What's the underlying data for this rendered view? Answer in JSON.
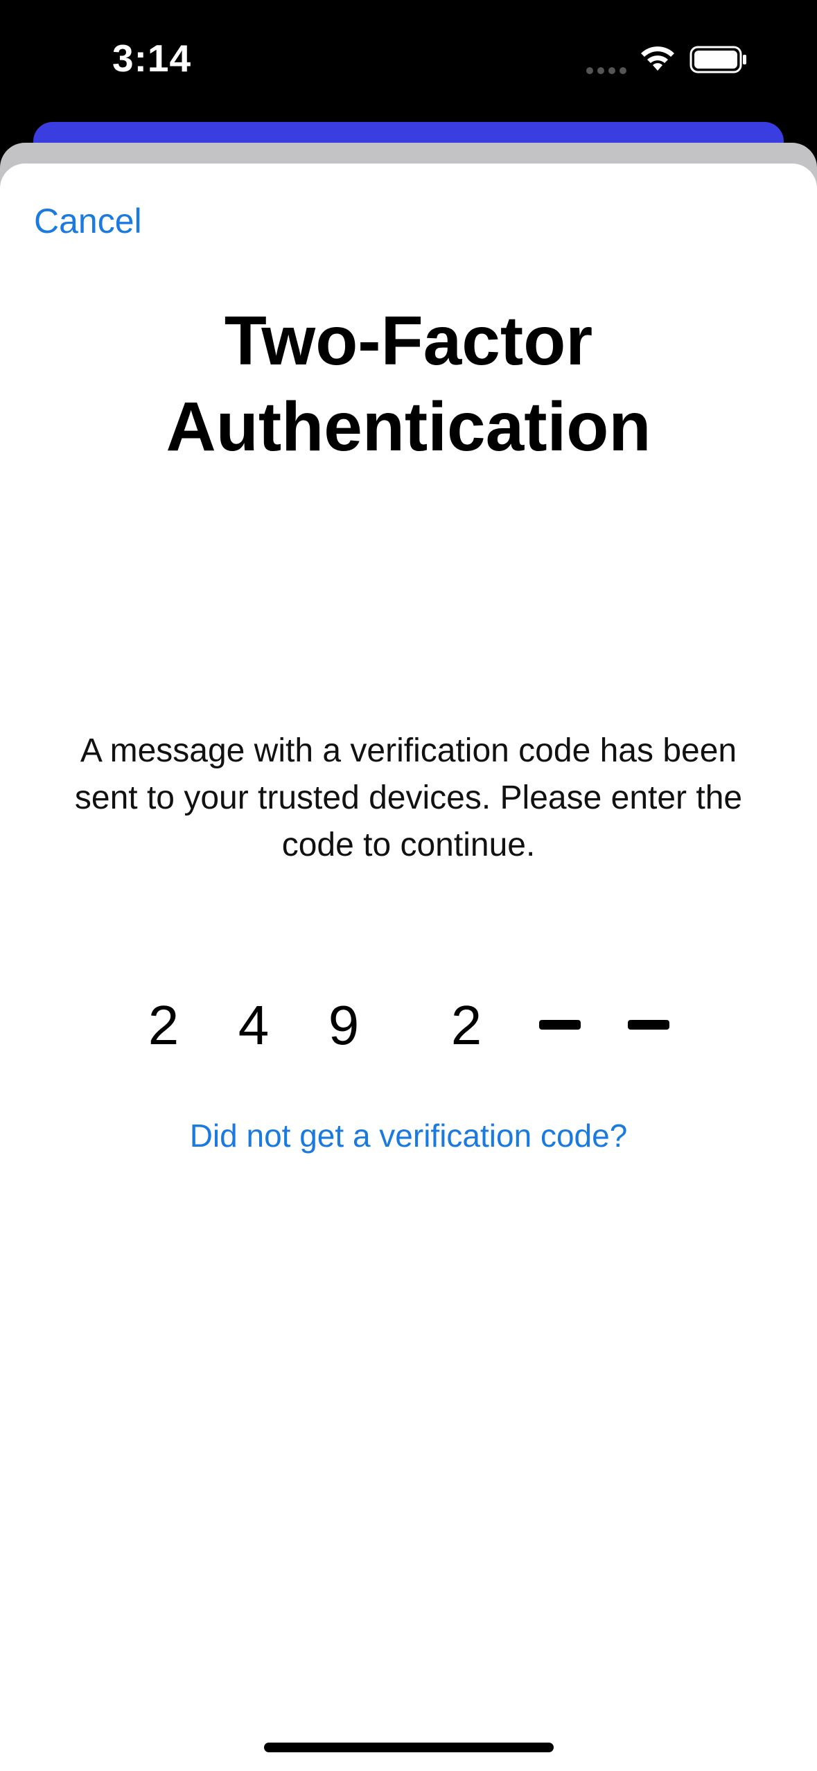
{
  "status_bar": {
    "time": "3:14",
    "icons": [
      "cellular-dots-icon",
      "wifi-icon",
      "battery-icon"
    ]
  },
  "nav": {
    "cancel_label": "Cancel"
  },
  "title": "Two-Factor Authentication",
  "message": "A message with a verification code has been sent to your trusted devices. Please enter the code to continue.",
  "code_entry": {
    "digits": [
      "2",
      "4",
      "9",
      "2",
      "",
      ""
    ],
    "entered_count": 4,
    "total_length": 6
  },
  "resend_link": "Did not get a verification code?",
  "colors": {
    "link": "#1a7ae0",
    "behind_card": "#3a3de0",
    "status_bar_bg": "#000000"
  }
}
